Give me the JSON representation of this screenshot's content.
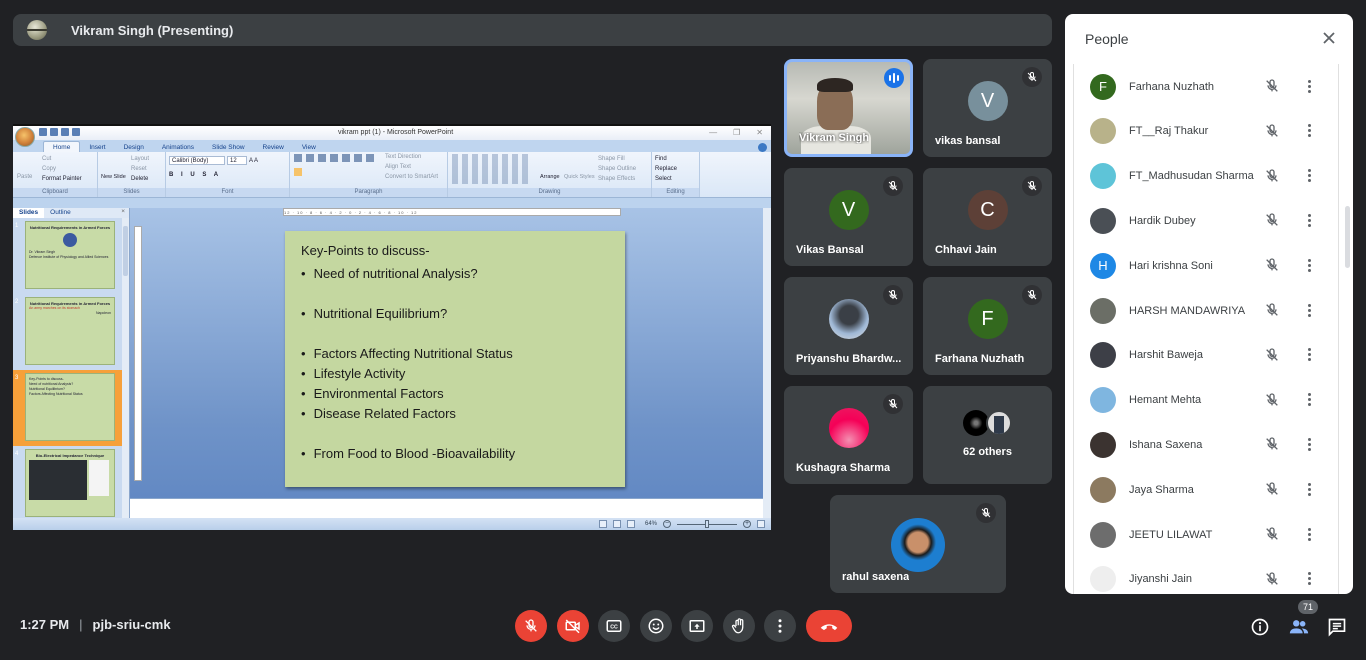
{
  "presenter_bar": {
    "label": "Vikram Singh (Presenting)"
  },
  "powerpoint": {
    "window_title": "vikram ppt (1) - Microsoft PowerPoint",
    "ribbon_tabs": [
      "Home",
      "Insert",
      "Design",
      "Animations",
      "Slide Show",
      "Review",
      "View"
    ],
    "active_tab": "Home",
    "groups": {
      "clipboard": {
        "label": "Clipboard",
        "paste": "Paste",
        "cut": "Cut",
        "copy": "Copy",
        "format_painter": "Format Painter"
      },
      "slides": {
        "label": "Slides",
        "new_slide": "New Slide",
        "layout": "Layout",
        "reset": "Reset",
        "delete": "Delete"
      },
      "font": {
        "label": "Font",
        "font_name": "Calibri (Body)",
        "font_size": "12"
      },
      "paragraph": {
        "label": "Paragraph",
        "text_direction": "Text Direction",
        "align_text": "Align Text",
        "convert_smartart": "Convert to SmartArt"
      },
      "drawing": {
        "label": "Drawing",
        "arrange": "Arrange",
        "quick_styles": "Quick Styles",
        "shape_fill": "Shape Fill",
        "shape_outline": "Shape Outline",
        "shape_effects": "Shape Effects"
      },
      "editing": {
        "label": "Editing",
        "find": "Find",
        "replace": "Replace",
        "select": "Select"
      }
    },
    "pane_tabs": [
      "Slides",
      "Outline"
    ],
    "thumbnails": [
      {
        "num": "1",
        "title": "Nutritional Requirements in Armed Forces",
        "lines": [
          "Dr. Vikram Singh",
          "Defence Institute of Physiology and Allied Sciences"
        ]
      },
      {
        "num": "2",
        "title": "Nutritional Requirements in Armed Forces",
        "lines": [
          "An army marches on its stomach",
          "Napoleon"
        ]
      },
      {
        "num": "3",
        "title": "Key-Points to discuss-",
        "lines": [
          "Need of nutritional Analysis?",
          "Nutritional Equilibrium?",
          "Factors Affecting Nutritional Status"
        ]
      },
      {
        "num": "4",
        "title": "Bio-Electrical Impedance Technique",
        "lines": []
      }
    ],
    "selected_slide": "3",
    "ruler_text": "12 · 10 · 8 · 6 · 4 · 2 · 0 · 2 · 4 · 6 · 8 · 10 · 12",
    "slide": {
      "heading": "Key-Points to discuss-",
      "bullets": [
        "Need of nutritional Analysis?",
        "Nutritional Equilibrium?",
        "Factors Affecting Nutritional Status",
        "Lifestyle Activity",
        "Environmental Factors",
        "Disease Related Factors",
        "From Food to Blood -Bioavailability"
      ]
    },
    "zoom_level": "64%"
  },
  "tiles": [
    {
      "name": "Vikram Singh",
      "speaking": true
    },
    {
      "name": "vikas bansal",
      "initial": "V",
      "color": "#78909c",
      "muted": true
    },
    {
      "name": "Vikas Bansal",
      "initial": "V",
      "color": "#33691e",
      "muted": true
    },
    {
      "name": "Chhavi Jain",
      "initial": "C",
      "color": "#5d4037",
      "muted": true
    },
    {
      "name": "Priyanshu Bhardw...",
      "muted": true
    },
    {
      "name": "Farhana Nuzhath",
      "initial": "F",
      "color": "#33691e",
      "muted": true
    },
    {
      "name": "Kushagra Sharma",
      "muted": true
    },
    {
      "name": "62 others"
    },
    {
      "name": "rahul saxena",
      "muted": true
    }
  ],
  "people_panel": {
    "title": "People",
    "participants": [
      {
        "name": "Farhana Nuzhath",
        "initial": "F",
        "color": "#33691e"
      },
      {
        "name": "FT__Raj Thakur",
        "color": "#b8b28a"
      },
      {
        "name": "FT_Madhusudan Sharma",
        "color": "#5ec4d8"
      },
      {
        "name": "Hardik Dubey",
        "color": "#4a4f55"
      },
      {
        "name": "Hari krishna Soni",
        "initial": "H",
        "color": "#1e88e5"
      },
      {
        "name": "HARSH MANDAWRIYA",
        "color": "#6b6e66"
      },
      {
        "name": "Harshit Baweja",
        "color": "#3d3f47"
      },
      {
        "name": "Hemant Mehta",
        "color": "#7fb6e0"
      },
      {
        "name": "Ishana Saxena",
        "color": "#3b3330"
      },
      {
        "name": "Jaya Sharma",
        "color": "#8c7a60"
      },
      {
        "name": "JEETU LILAWAT",
        "color": "#6d6d6d"
      },
      {
        "name": "Jiyanshi Jain",
        "color": "#eeeeee"
      }
    ]
  },
  "bottom_bar": {
    "time": "1:27 PM",
    "separator": "|",
    "meeting_code": "pjb-sriu-cmk",
    "participant_count": "71"
  },
  "colors": {
    "accent": "#8ab4f8",
    "danger": "#ea4335",
    "tile": "#3c4043",
    "background": "#202124"
  }
}
